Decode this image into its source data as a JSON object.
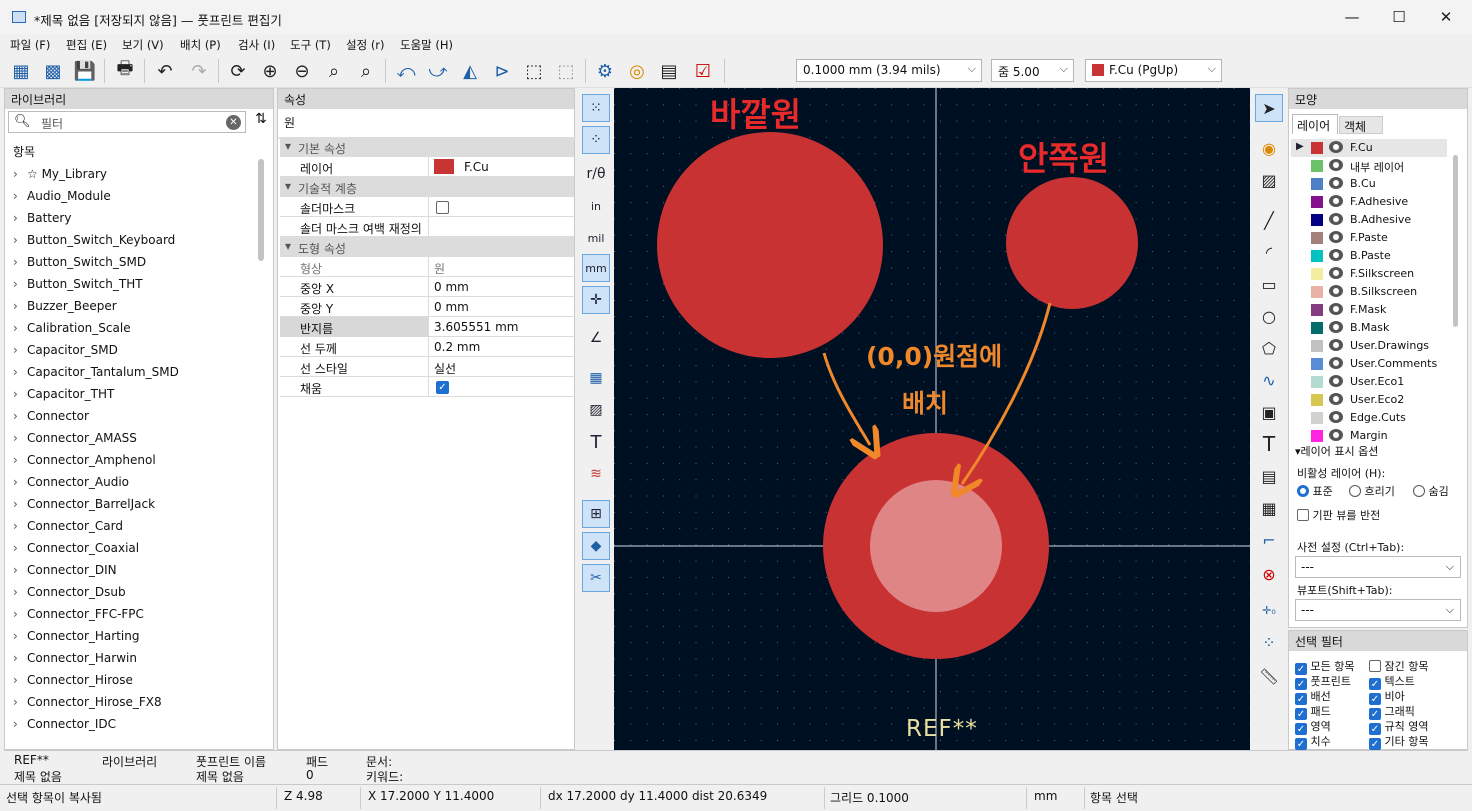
{
  "window": {
    "title": "*제목 없음 [저장되지 않음] — 풋프린트 편집기",
    "minimize": "—",
    "maximize": "☐",
    "close": "✕"
  },
  "menu": [
    "파일 (F)",
    "편집 (E)",
    "보기 (V)",
    "배치 (P)",
    "검사 (I)",
    "도구 (T)",
    "설정 (r)",
    "도움말 (H)"
  ],
  "toolbar": {
    "grid_value": "0.1000 mm (3.94 mils)",
    "zoom_value": "줌 5.00",
    "layer_value": "F.Cu (PgUp)",
    "layer_color": "#c83434"
  },
  "library": {
    "header": "라이브러리",
    "filter_placeholder": "필터",
    "column_header": "항목",
    "items": [
      "☆ My_Library",
      "Audio_Module",
      "Battery",
      "Button_Switch_Keyboard",
      "Button_Switch_SMD",
      "Button_Switch_THT",
      "Buzzer_Beeper",
      "Calibration_Scale",
      "Capacitor_SMD",
      "Capacitor_Tantalum_SMD",
      "Capacitor_THT",
      "Connector",
      "Connector_AMASS",
      "Connector_Amphenol",
      "Connector_Audio",
      "Connector_BarrelJack",
      "Connector_Card",
      "Connector_Coaxial",
      "Connector_DIN",
      "Connector_Dsub",
      "Connector_FFC-FPC",
      "Connector_Harting",
      "Connector_Harwin",
      "Connector_Hirose",
      "Connector_Hirose_FX8",
      "Connector_IDC"
    ]
  },
  "properties": {
    "header": "속성",
    "subtitle": "원",
    "sections": {
      "basic": "기본 속성",
      "tech": "기술적 계층",
      "shape": "도형 속성"
    },
    "layer_label": "레이어",
    "layer_value": "F.Cu",
    "soldermask_label": "솔더마스크",
    "soldermask_margin_label": "솔더 마스크 여백 재정의",
    "shape_label": "형상",
    "shape_value": "원",
    "center_x_label": "중앙 X",
    "center_x_value": "0 mm",
    "center_y_label": "중앙 Y",
    "center_y_value": "0 mm",
    "radius_label": "반지름",
    "radius_value": "3.605551 mm",
    "line_width_label": "선 두께",
    "line_width_value": "0.2 mm",
    "line_style_label": "선 스타일",
    "line_style_value": "실선",
    "fill_label": "채움"
  },
  "canvas": {
    "annotation_outer": "바깥원",
    "annotation_inner": "안쪽원",
    "annotation_origin_1": "(0,0)원점에",
    "annotation_origin_2": "배치",
    "ref_text": "REF**",
    "circle_color": "#c83232",
    "inner_fill_color": "#e08585",
    "annotation_red": "#e82a2a",
    "annotation_orange": "#f0882a"
  },
  "appearance": {
    "header": "모양",
    "tab_layers": "레이어",
    "tab_objects": "객체",
    "layers": [
      {
        "name": "F.Cu",
        "color": "#c83434"
      },
      {
        "name": "내부 레이어",
        "color": "#6ac26a"
      },
      {
        "name": "B.Cu",
        "color": "#4d7fc4"
      },
      {
        "name": "F.Adhesive",
        "color": "#84128c"
      },
      {
        "name": "B.Adhesive",
        "color": "#040084"
      },
      {
        "name": "F.Paste",
        "color": "#a3817d"
      },
      {
        "name": "B.Paste",
        "color": "#00c2c2"
      },
      {
        "name": "F.Silkscreen",
        "color": "#f2eda1"
      },
      {
        "name": "B.Silkscreen",
        "color": "#e8b2a7"
      },
      {
        "name": "F.Mask",
        "color": "#833c7f"
      },
      {
        "name": "B.Mask",
        "color": "#026b6b"
      },
      {
        "name": "User.Drawings",
        "color": "#c2c2c2"
      },
      {
        "name": "User.Comments",
        "color": "#598cd6"
      },
      {
        "name": "User.Eco1",
        "color": "#b4dbd2"
      },
      {
        "name": "User.Eco2",
        "color": "#d8c852"
      },
      {
        "name": "Edge.Cuts",
        "color": "#d0d2cd"
      },
      {
        "name": "Margin",
        "color": "#ff26e2"
      }
    ],
    "display_options": "레이어 표시 옵션",
    "inactive_label": "비활성 레이어 (H):",
    "opt_normal": "표준",
    "opt_dim": "흐리기",
    "opt_hide": "숨김",
    "flip_board": "기판 뷰를 반전",
    "preset_label": "사전 설정 (Ctrl+Tab):",
    "preset_value": "---",
    "viewport_label": "뷰포트(Shift+Tab):",
    "viewport_value": "---"
  },
  "selection_filter": {
    "header": "선택 필터",
    "items": [
      {
        "label": "모든 항목",
        "checked": true
      },
      {
        "label": "잠긴 항목",
        "checked": false
      },
      {
        "label": "풋프린트",
        "checked": true
      },
      {
        "label": "텍스트",
        "checked": true
      },
      {
        "label": "배선",
        "checked": true
      },
      {
        "label": "비아",
        "checked": true
      },
      {
        "label": "패드",
        "checked": true
      },
      {
        "label": "그래픽",
        "checked": true
      },
      {
        "label": "영역",
        "checked": true
      },
      {
        "label": "규칙 영역",
        "checked": true
      },
      {
        "label": "치수",
        "checked": true
      },
      {
        "label": "기타 항목",
        "checked": true
      }
    ]
  },
  "infobar": {
    "ref": "REF**",
    "ref_sub": "제목 없음",
    "lib_label": "라이브러리",
    "fp_label": "풋프린트 이름",
    "fp_value": "제목 없음",
    "pad_label": "패드",
    "pad_value": "0",
    "doc_label": "문서:",
    "kw_label": "키워드:"
  },
  "status": {
    "message": "선택 항목이 복사됨",
    "zoom": "Z 4.98",
    "xy": "X 17.2000  Y 11.4000",
    "delta": "dx 17.2000  dy 11.4000  dist 20.6349",
    "grid": "그리드 0.1000",
    "units": "mm",
    "mode": "항목 선택"
  }
}
